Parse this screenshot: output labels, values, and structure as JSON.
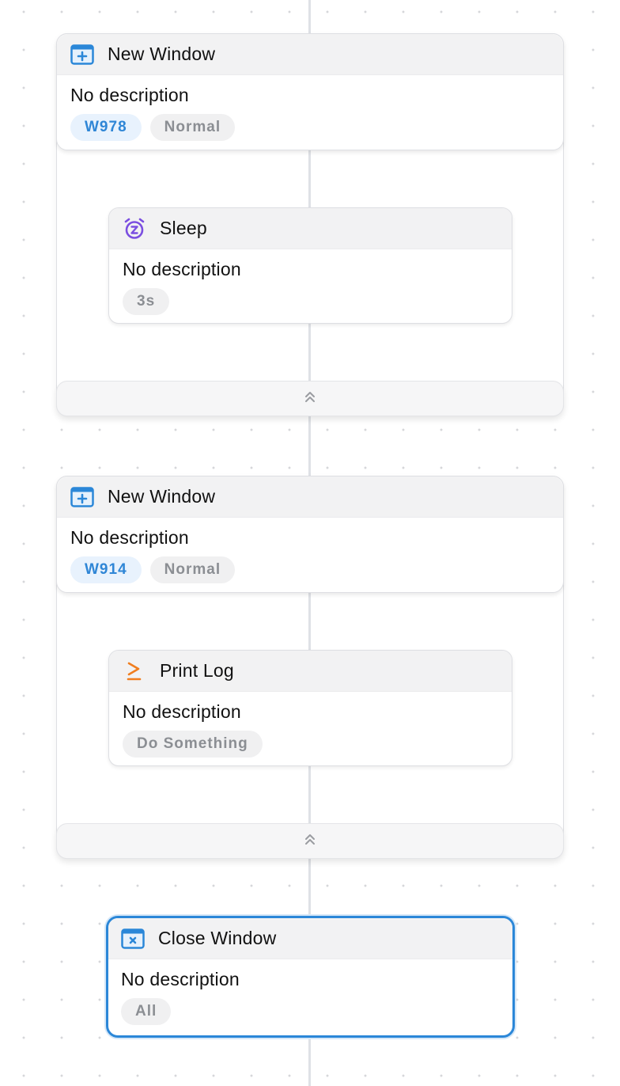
{
  "canvas": {
    "background": "#ffffff",
    "dot_color": "#d6d7da",
    "connector_color": "#dfe1e6"
  },
  "colors": {
    "accent_blue": "#2b87d8",
    "sleep_purple": "#7b4fe0",
    "log_orange": "#f07e1f",
    "tag_id_text": "#2f86d6",
    "tag_text": "#8b8e93"
  },
  "groups": [
    {
      "header": {
        "icon": "window-plus-icon",
        "title": "New Window",
        "description": "No description",
        "tags": [
          "W978",
          "Normal"
        ]
      },
      "children": [
        {
          "icon": "alarm-clock-z-icon",
          "title": "Sleep",
          "description": "No description",
          "tags": [
            "3s"
          ]
        }
      ],
      "footer": {
        "icon": "collapse-chevrons-up-icon"
      }
    },
    {
      "header": {
        "icon": "window-plus-icon",
        "title": "New Window",
        "description": "No description",
        "tags": [
          "W914",
          "Normal"
        ]
      },
      "children": [
        {
          "icon": "terminal-prompt-icon",
          "title": "Print Log",
          "description": "No description",
          "tags": [
            "Do Something"
          ]
        }
      ],
      "footer": {
        "icon": "collapse-chevrons-up-icon"
      }
    }
  ],
  "close_window": {
    "icon": "window-close-icon",
    "title": "Close Window",
    "description": "No description",
    "tags": [
      "All"
    ],
    "selected": true
  }
}
